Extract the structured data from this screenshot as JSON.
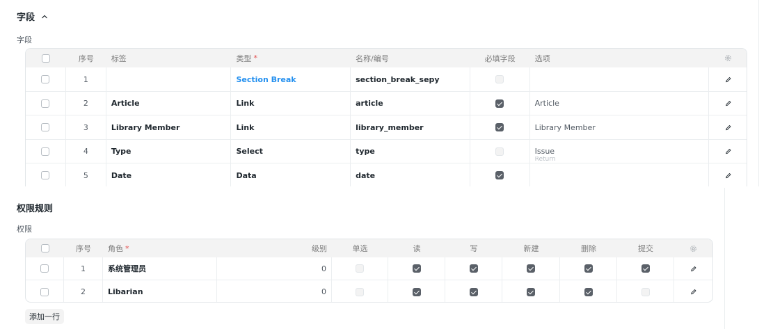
{
  "fields_section": {
    "title": "字段",
    "field_label": "字段",
    "headers": {
      "index": "序号",
      "label": "标签",
      "type": "类型",
      "fieldname": "名称/编号",
      "mandatory": "必填字段",
      "options": "选项"
    },
    "required_mark": "*",
    "rows": [
      {
        "index": "1",
        "label": "",
        "type": "Section Break",
        "fieldname": "section_break_sepy",
        "mandatory": false,
        "mandatory_disabled": true,
        "options": ""
      },
      {
        "index": "2",
        "label": "Article",
        "type": "Link",
        "fieldname": "article",
        "mandatory": true,
        "mandatory_disabled": false,
        "options": "Article"
      },
      {
        "index": "3",
        "label": "Library Member",
        "type": "Link",
        "fieldname": "library_member",
        "mandatory": true,
        "mandatory_disabled": false,
        "options": "Library Member"
      },
      {
        "index": "4",
        "label": "Type",
        "type": "Select",
        "fieldname": "type",
        "mandatory": false,
        "mandatory_disabled": true,
        "options": "Issue",
        "options_line2": "Return"
      },
      {
        "index": "5",
        "label": "Date",
        "type": "Data",
        "fieldname": "date",
        "mandatory": true,
        "mandatory_disabled": false,
        "options": ""
      }
    ]
  },
  "permissions_section": {
    "title": "权限规则",
    "field_label": "权限",
    "headers": {
      "index": "序号",
      "role": "角色",
      "level": "级别",
      "if_owner": "单选",
      "read": "读",
      "write": "写",
      "create": "新建",
      "delete": "删除",
      "submit": "提交"
    },
    "required_mark": "*",
    "rows": [
      {
        "index": "1",
        "role": "系统管理员",
        "level": "0",
        "if_owner": false,
        "read": true,
        "write": true,
        "create": true,
        "delete": true,
        "submit": true
      },
      {
        "index": "2",
        "role": "Libarian",
        "level": "0",
        "if_owner": false,
        "read": true,
        "write": true,
        "create": true,
        "delete": true,
        "submit": false
      }
    ],
    "add_row_label": "添加一行"
  },
  "icons": {
    "collapse": "chevron-up-icon",
    "settings": "gear-icon",
    "edit": "pencil-icon"
  },
  "colors": {
    "link": "#2490ef",
    "required": "#e24c4c",
    "checked": "#5a6068",
    "header_bg": "#f3f3f3"
  }
}
